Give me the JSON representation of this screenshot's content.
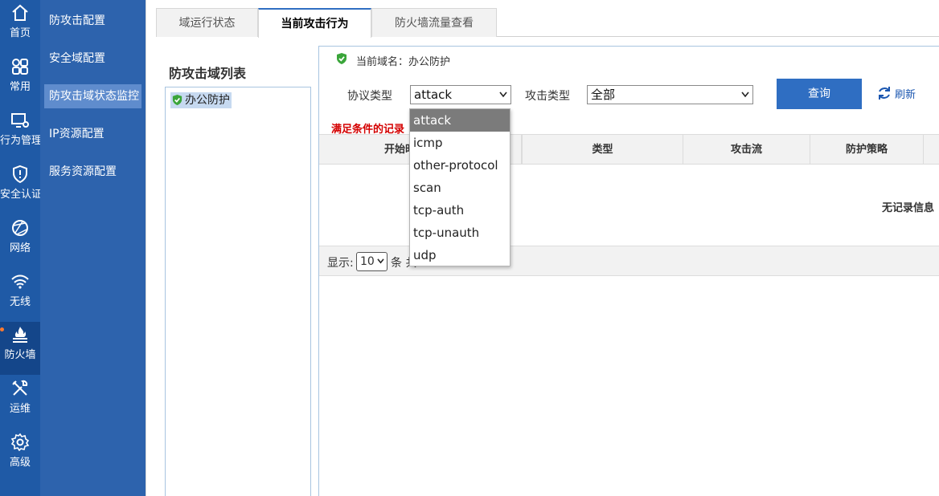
{
  "rail": [
    {
      "label": "首页",
      "icon": "home-icon"
    },
    {
      "label": "常用",
      "icon": "grid-icon"
    },
    {
      "label": "行为管理",
      "icon": "monitor-gear-icon"
    },
    {
      "label": "安全认证",
      "icon": "shield-icon"
    },
    {
      "label": "网络",
      "icon": "network-icon"
    },
    {
      "label": "无线",
      "icon": "wifi-icon"
    },
    {
      "label": "防火墙",
      "icon": "firewall-icon"
    },
    {
      "label": "运维",
      "icon": "tools-icon"
    },
    {
      "label": "高级",
      "icon": "gear-icon"
    }
  ],
  "subnav": [
    {
      "label": "防攻击配置"
    },
    {
      "label": "安全域配置"
    },
    {
      "label": "防攻击域状态监控"
    },
    {
      "label": "IP资源配置"
    },
    {
      "label": "服务资源配置"
    }
  ],
  "tabs": [
    {
      "label": "域运行状态"
    },
    {
      "label": "当前攻击行为"
    },
    {
      "label": "防火墙流量查看"
    }
  ],
  "domain_list": {
    "title": "防攻击域列表",
    "items": [
      "办公防护"
    ]
  },
  "current_domain": {
    "label": "当前域名：",
    "value": "办公防护"
  },
  "filters": {
    "protocol_label": "协议类型",
    "protocol_value": "attack",
    "protocol_options": [
      "attack",
      "icmp",
      "other-protocol",
      "scan",
      "tcp-auth",
      "tcp-unauth",
      "udp"
    ],
    "attack_label": "攻击类型",
    "attack_value": "全部"
  },
  "buttons": {
    "query": "查询",
    "refresh": "刷新"
  },
  "hint": "满足条件的记录",
  "table": {
    "headers": [
      "开始时",
      "类型",
      "攻击流",
      "防护策略"
    ],
    "empty": "无记录信息"
  },
  "pager": {
    "show_label": "显示:",
    "page_size": "10",
    "unit": "条 共"
  },
  "colors": {
    "rail": "#1f5aa6",
    "subnav": "#2d63ad",
    "accent": "#2f6ec2",
    "alert": "#d40000"
  }
}
